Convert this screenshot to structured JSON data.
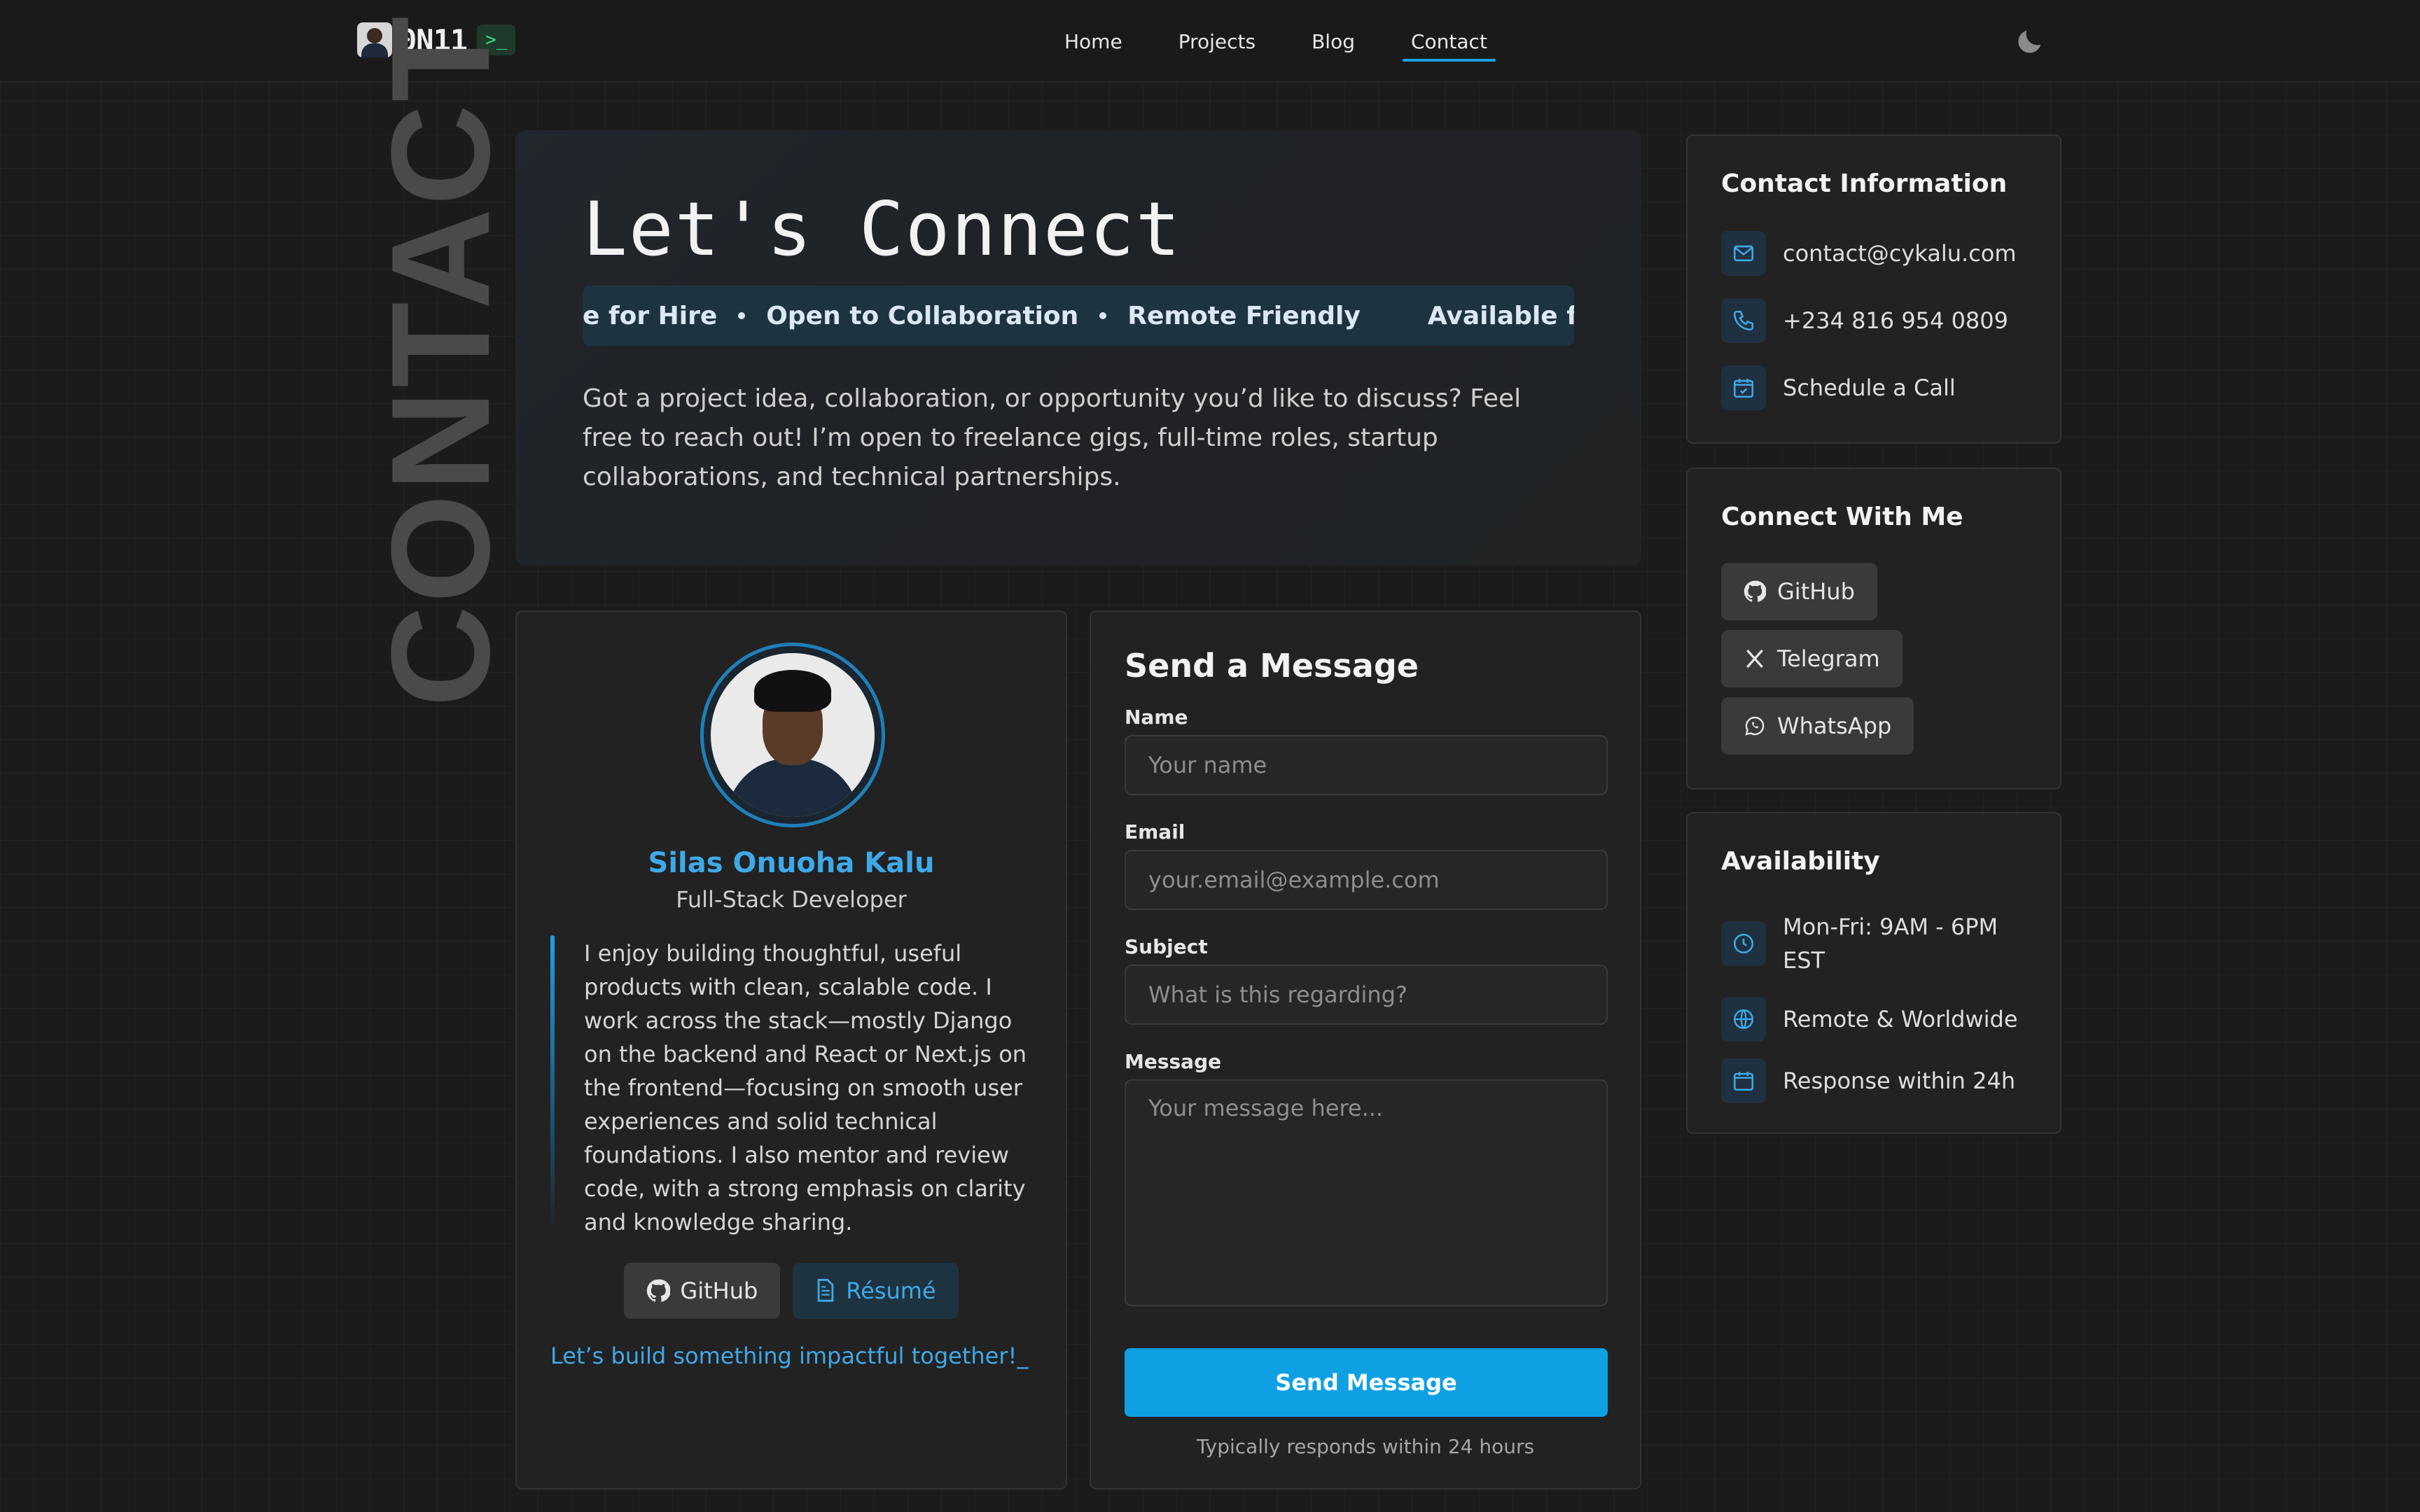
{
  "nav": {
    "logo_text": "0N11",
    "logo_terminal": ">_",
    "links": [
      "Home",
      "Projects",
      "Blog",
      "Contact"
    ],
    "active_link": "Contact"
  },
  "side_label": "CONTACT",
  "hero": {
    "title": "Let's Connect",
    "ticker": [
      "e for Hire",
      "Open to Collaboration",
      "Remote Friendly",
      "Available for Hire"
    ],
    "description": "Got a project idea, collaboration, or opportunity you’d like to discuss? Feel free to reach out! I’m open to freelance gigs, full-time roles, startup collaborations, and technical partnerships."
  },
  "profile": {
    "name": "Silas Onuoha Kalu",
    "role": "Full-Stack Developer",
    "bio": "I enjoy building thoughtful, useful products with clean, scalable code. I work across the stack—mostly Django on the backend and React or Next.js on the frontend—focusing on smooth user experiences and solid technical foundations. I also mentor and review code, with a strong emphasis on clarity and knowledge sharing.",
    "github_label": "GitHub",
    "resume_label": "Résumé",
    "tagline": "Let’s build something impactful together!_"
  },
  "form": {
    "title": "Send a Message",
    "name_label": "Name",
    "name_placeholder": "Your name",
    "email_label": "Email",
    "email_placeholder": "your.email@example.com",
    "subject_label": "Subject",
    "subject_placeholder": "What is this regarding?",
    "message_label": "Message",
    "message_placeholder": "Your message here...",
    "submit_label": "Send Message",
    "response_note": "Typically responds within 24 hours"
  },
  "contact_info": {
    "title": "Contact Information",
    "email": "contact@cykalu.com",
    "phone": "+234 816 954 0809",
    "schedule": "Schedule a Call"
  },
  "connect": {
    "title": "Connect With Me",
    "github": "GitHub",
    "telegram": "Telegram",
    "whatsapp": "WhatsApp"
  },
  "availability": {
    "title": "Availability",
    "hours": "Mon-Fri: 9AM - 6PM EST",
    "location": "Remote & Worldwide",
    "response": "Response within 24h"
  },
  "colors": {
    "accent": "#0ea0e3",
    "accent_text": "#3fa9e8",
    "background": "#1b1b1b",
    "card": "#222222"
  }
}
